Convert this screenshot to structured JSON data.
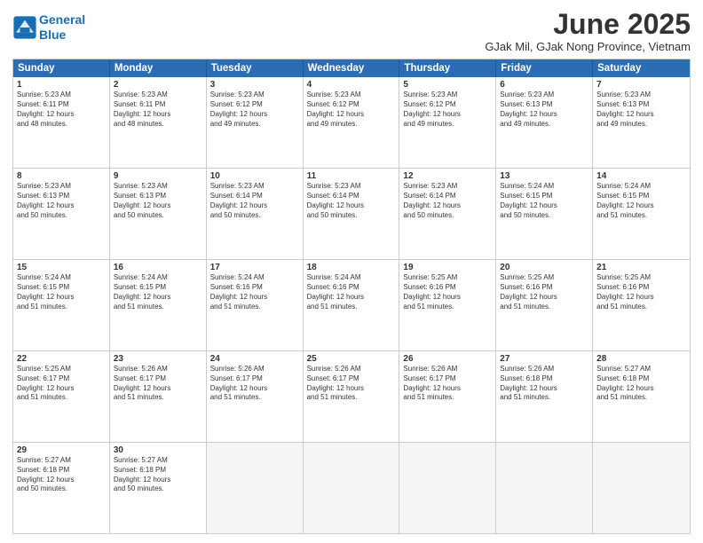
{
  "logo": {
    "line1": "General",
    "line2": "Blue"
  },
  "title": "June 2025",
  "subtitle": "GJak Mil, GJak Nong Province, Vietnam",
  "header_days": [
    "Sunday",
    "Monday",
    "Tuesday",
    "Wednesday",
    "Thursday",
    "Friday",
    "Saturday"
  ],
  "weeks": [
    [
      {
        "day": "1",
        "info": "Sunrise: 5:23 AM\nSunset: 6:11 PM\nDaylight: 12 hours\nand 48 minutes."
      },
      {
        "day": "2",
        "info": "Sunrise: 5:23 AM\nSunset: 6:11 PM\nDaylight: 12 hours\nand 48 minutes."
      },
      {
        "day": "3",
        "info": "Sunrise: 5:23 AM\nSunset: 6:12 PM\nDaylight: 12 hours\nand 49 minutes."
      },
      {
        "day": "4",
        "info": "Sunrise: 5:23 AM\nSunset: 6:12 PM\nDaylight: 12 hours\nand 49 minutes."
      },
      {
        "day": "5",
        "info": "Sunrise: 5:23 AM\nSunset: 6:12 PM\nDaylight: 12 hours\nand 49 minutes."
      },
      {
        "day": "6",
        "info": "Sunrise: 5:23 AM\nSunset: 6:13 PM\nDaylight: 12 hours\nand 49 minutes."
      },
      {
        "day": "7",
        "info": "Sunrise: 5:23 AM\nSunset: 6:13 PM\nDaylight: 12 hours\nand 49 minutes."
      }
    ],
    [
      {
        "day": "8",
        "info": "Sunrise: 5:23 AM\nSunset: 6:13 PM\nDaylight: 12 hours\nand 50 minutes."
      },
      {
        "day": "9",
        "info": "Sunrise: 5:23 AM\nSunset: 6:13 PM\nDaylight: 12 hours\nand 50 minutes."
      },
      {
        "day": "10",
        "info": "Sunrise: 5:23 AM\nSunset: 6:14 PM\nDaylight: 12 hours\nand 50 minutes."
      },
      {
        "day": "11",
        "info": "Sunrise: 5:23 AM\nSunset: 6:14 PM\nDaylight: 12 hours\nand 50 minutes."
      },
      {
        "day": "12",
        "info": "Sunrise: 5:23 AM\nSunset: 6:14 PM\nDaylight: 12 hours\nand 50 minutes."
      },
      {
        "day": "13",
        "info": "Sunrise: 5:24 AM\nSunset: 6:15 PM\nDaylight: 12 hours\nand 50 minutes."
      },
      {
        "day": "14",
        "info": "Sunrise: 5:24 AM\nSunset: 6:15 PM\nDaylight: 12 hours\nand 51 minutes."
      }
    ],
    [
      {
        "day": "15",
        "info": "Sunrise: 5:24 AM\nSunset: 6:15 PM\nDaylight: 12 hours\nand 51 minutes."
      },
      {
        "day": "16",
        "info": "Sunrise: 5:24 AM\nSunset: 6:15 PM\nDaylight: 12 hours\nand 51 minutes."
      },
      {
        "day": "17",
        "info": "Sunrise: 5:24 AM\nSunset: 6:16 PM\nDaylight: 12 hours\nand 51 minutes."
      },
      {
        "day": "18",
        "info": "Sunrise: 5:24 AM\nSunset: 6:16 PM\nDaylight: 12 hours\nand 51 minutes."
      },
      {
        "day": "19",
        "info": "Sunrise: 5:25 AM\nSunset: 6:16 PM\nDaylight: 12 hours\nand 51 minutes."
      },
      {
        "day": "20",
        "info": "Sunrise: 5:25 AM\nSunset: 6:16 PM\nDaylight: 12 hours\nand 51 minutes."
      },
      {
        "day": "21",
        "info": "Sunrise: 5:25 AM\nSunset: 6:16 PM\nDaylight: 12 hours\nand 51 minutes."
      }
    ],
    [
      {
        "day": "22",
        "info": "Sunrise: 5:25 AM\nSunset: 6:17 PM\nDaylight: 12 hours\nand 51 minutes."
      },
      {
        "day": "23",
        "info": "Sunrise: 5:26 AM\nSunset: 6:17 PM\nDaylight: 12 hours\nand 51 minutes."
      },
      {
        "day": "24",
        "info": "Sunrise: 5:26 AM\nSunset: 6:17 PM\nDaylight: 12 hours\nand 51 minutes."
      },
      {
        "day": "25",
        "info": "Sunrise: 5:26 AM\nSunset: 6:17 PM\nDaylight: 12 hours\nand 51 minutes."
      },
      {
        "day": "26",
        "info": "Sunrise: 5:26 AM\nSunset: 6:17 PM\nDaylight: 12 hours\nand 51 minutes."
      },
      {
        "day": "27",
        "info": "Sunrise: 5:26 AM\nSunset: 6:18 PM\nDaylight: 12 hours\nand 51 minutes."
      },
      {
        "day": "28",
        "info": "Sunrise: 5:27 AM\nSunset: 6:18 PM\nDaylight: 12 hours\nand 51 minutes."
      }
    ],
    [
      {
        "day": "29",
        "info": "Sunrise: 5:27 AM\nSunset: 6:18 PM\nDaylight: 12 hours\nand 50 minutes."
      },
      {
        "day": "30",
        "info": "Sunrise: 5:27 AM\nSunset: 6:18 PM\nDaylight: 12 hours\nand 50 minutes."
      },
      {
        "day": "",
        "info": ""
      },
      {
        "day": "",
        "info": ""
      },
      {
        "day": "",
        "info": ""
      },
      {
        "day": "",
        "info": ""
      },
      {
        "day": "",
        "info": ""
      }
    ]
  ]
}
